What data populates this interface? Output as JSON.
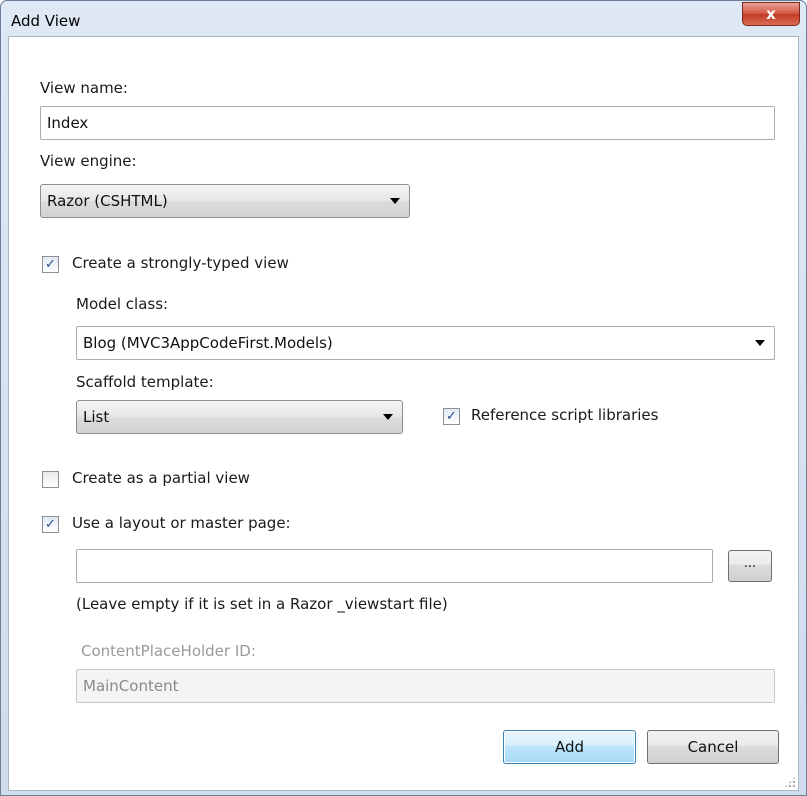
{
  "window": {
    "title": "Add View",
    "close_label": "x"
  },
  "form": {
    "view_name_label": "View name:",
    "view_name_value": "Index",
    "view_engine_label": "View engine:",
    "view_engine_value": "Razor (CSHTML)",
    "strongly_typed": {
      "label": "Create a strongly-typed view",
      "checked": true
    },
    "model_class_label": "Model class:",
    "model_class_value": "Blog (MVC3AppCodeFirst.Models)",
    "scaffold_label": "Scaffold template:",
    "scaffold_value": "List",
    "reference_scripts": {
      "label": "Reference script libraries",
      "checked": true
    },
    "partial_view": {
      "label": "Create as a partial view",
      "checked": false
    },
    "use_layout": {
      "label": "Use a layout or master page:",
      "checked": true
    },
    "layout_path_value": "",
    "browse_label": "...",
    "layout_hint": "(Leave empty if it is set in a Razor _viewstart file)",
    "placeholder_id_label": "ContentPlaceHolder ID:",
    "placeholder_id_value": "MainContent"
  },
  "buttons": {
    "add_label": "Add",
    "cancel_label": "Cancel"
  },
  "check_glyph": "✓"
}
